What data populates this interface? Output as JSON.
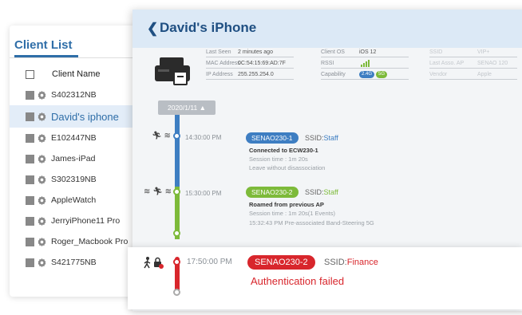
{
  "client_list": {
    "title": "Client List",
    "column_header": "Client Name",
    "clients": [
      {
        "name": "S402312NB"
      },
      {
        "name": "David's iphone",
        "selected": true
      },
      {
        "name": "E102447NB"
      },
      {
        "name": "James-iPad"
      },
      {
        "name": "S302319NB"
      },
      {
        "name": "AppleWatch"
      },
      {
        "name": "JerryiPhone11 Pro"
      },
      {
        "name": "Roger_Macbook Pro"
      },
      {
        "name": "S421775NB"
      }
    ]
  },
  "detail": {
    "back_icon": "chevron-left-icon",
    "back_glyph": "❮",
    "title": "David's iPhone",
    "info": {
      "last_seen_label": "Last Seen",
      "last_seen": "2 minutes ago",
      "mac_label": "MAC Address",
      "mac": "0C:54:15:69:AD:7F",
      "ip_label": "IP Address",
      "ip": "255.255.254.0",
      "os_label": "Client OS",
      "os": "iOS 12",
      "rssi_label": "RSSI",
      "capability_label": "Capability",
      "cap_24": "2.4G",
      "cap_5": "5G",
      "ssid_label": "SSID",
      "ssid": "VIP+",
      "last_ap_label": "Last Asso. AP",
      "last_ap": "SENAO 120",
      "vendor_label": "Vendor",
      "vendor": "Apple"
    },
    "date_pill": "2020/1/11",
    "date_chevron": "▲",
    "events": [
      {
        "time": "14:30:00 PM",
        "icons": "🏃︎ ≋",
        "ap": "SENAO230-1",
        "ssid_label": "SSID:",
        "ssid": "Staff",
        "title": "Connected to ECW230-1",
        "line2": "Session time : 1m 20s",
        "line3": "Leave without disassociation"
      },
      {
        "time": "15:30:00 PM",
        "icons": "≋ 🏃︎ ≋",
        "ap": "SENAO230-2",
        "ssid_label": "SSID:",
        "ssid": "Staff",
        "title": "Roamed from previous AP",
        "line2": "Session time : 1m 20s(1 Events)",
        "line3": "15:32:43 PM   Pre-associated Band-Steering 5G"
      }
    ],
    "failure": {
      "time": "17:50:00 PM",
      "ap": "SENAO230-2",
      "ssid_label": "SSID:",
      "ssid": "Finance",
      "message": "Authentication failed"
    }
  },
  "colors": {
    "brand_blue": "#2f6ea8",
    "timeline_blue": "#3e7ec2",
    "timeline_green": "#7dba3a",
    "failure_red": "#d8262c"
  }
}
